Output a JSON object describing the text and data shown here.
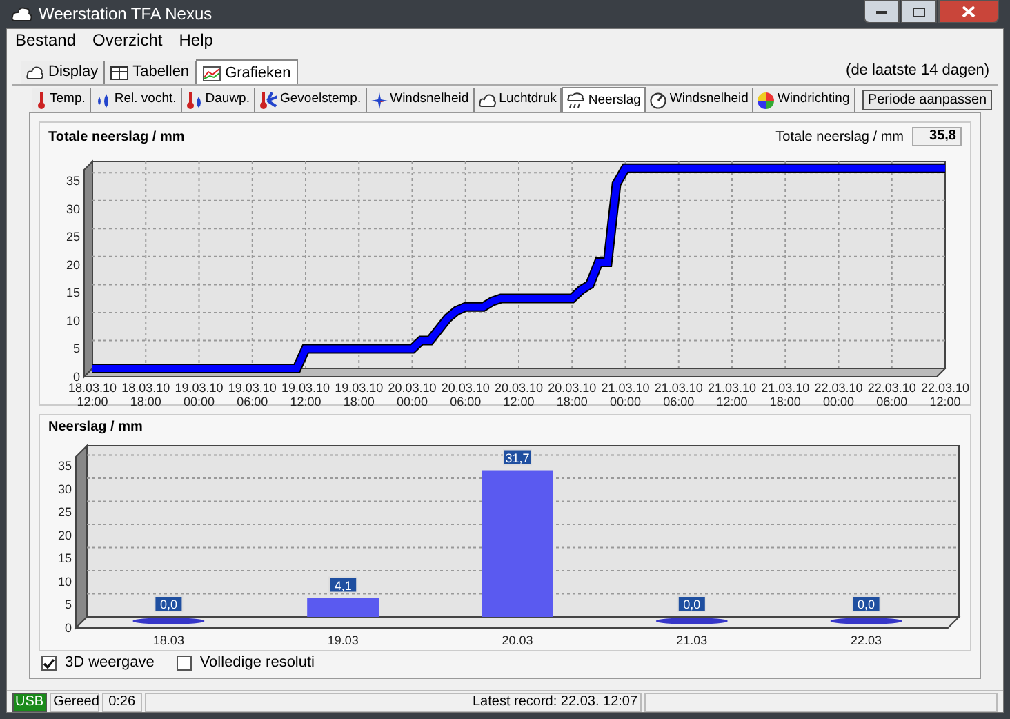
{
  "window": {
    "title": "Weerstation TFA Nexus"
  },
  "menu": [
    "Bestand",
    "Overzicht",
    "Help"
  ],
  "view_tabs": [
    {
      "label": "Display",
      "selected": false
    },
    {
      "label": "Tabellen",
      "selected": false
    },
    {
      "label": "Grafieken",
      "selected": true
    }
  ],
  "period_note": "(de laatste 14 dagen)",
  "chart_tabs": [
    {
      "label": "Temp.",
      "selected": false
    },
    {
      "label": "Rel. vocht.",
      "selected": false
    },
    {
      "label": "Dauwp.",
      "selected": false
    },
    {
      "label": "Gevoelstemp.",
      "selected": false
    },
    {
      "label": "Windsnelheid",
      "selected": false
    },
    {
      "label": "Luchtdruk",
      "selected": false
    },
    {
      "label": "Neerslag",
      "selected": true
    },
    {
      "label": "Windsnelheid",
      "selected": false
    },
    {
      "label": "Windrichting",
      "selected": false
    }
  ],
  "period_button": "Periode aanpassen",
  "total_panel": {
    "readout_label": "Totale neerslag / mm",
    "readout_value": "35,8",
    "chart_data": {
      "type": "line",
      "title": "Totale neerslag / mm",
      "categories": [
        "18.03.10 12:00",
        null,
        null,
        null,
        null,
        null,
        "18.03.10 18:00",
        null,
        null,
        null,
        null,
        null,
        "19.03.10 00:00",
        null,
        null,
        null,
        null,
        null,
        "19.03.10 06:00",
        null,
        null,
        null,
        null,
        null,
        "19.03.10 12:00",
        null,
        null,
        null,
        null,
        null,
        "19.03.10 18:00",
        null,
        null,
        null,
        null,
        null,
        "20.03.10 00:00",
        null,
        null,
        null,
        null,
        null,
        "20.03.10 06:00",
        null,
        null,
        null,
        null,
        null,
        "20.03.10 12:00",
        null,
        null,
        null,
        null,
        null,
        "20.03.10 18:00",
        null,
        null,
        null,
        null,
        null,
        "21.03.10 00:00",
        null,
        null,
        null,
        null,
        null,
        "21.03.10 06:00",
        null,
        null,
        null,
        null,
        null,
        "21.03.10 12:00",
        null,
        null,
        null,
        null,
        null,
        "21.03.10 18:00",
        null,
        null,
        null,
        null,
        null,
        "22.03.10 00:00",
        null,
        null,
        null,
        null,
        null,
        "22.03.10 06:00",
        null,
        null,
        null,
        null,
        null,
        "22.03.10 12:00"
      ],
      "series": [
        {
          "color": "#0000ff",
          "values": [
            0,
            0,
            0,
            0,
            0,
            0,
            0,
            0,
            0,
            0,
            0,
            0,
            0,
            0,
            0,
            0,
            0,
            0,
            0,
            0,
            0,
            0,
            0,
            0,
            3.5,
            3.5,
            3.5,
            3.5,
            3.5,
            3.5,
            3.5,
            3.5,
            3.5,
            3.5,
            3.5,
            3.5,
            3.5,
            5,
            5,
            7,
            9,
            10.3,
            11,
            11,
            11,
            12,
            12.5,
            12.5,
            12.5,
            12.5,
            12.5,
            12.5,
            12.5,
            12.5,
            12.5,
            14,
            15,
            19,
            19,
            33,
            35.8,
            35.8,
            35.8,
            35.8,
            35.8,
            35.8,
            35.8,
            35.8,
            35.8,
            35.8,
            35.8,
            35.8,
            35.8,
            35.8,
            35.8,
            35.8,
            35.8,
            35.8,
            35.8,
            35.8,
            35.8,
            35.8,
            35.8,
            35.8,
            35.8,
            35.8,
            35.8,
            35.8,
            35.8,
            35.8,
            35.8,
            35.8,
            35.8,
            35.8,
            35.8,
            35.8,
            35.8
          ]
        }
      ],
      "ylim": [
        0,
        37
      ],
      "grid": true,
      "yticks": [
        0,
        5,
        10,
        15,
        20,
        25,
        30,
        35
      ]
    }
  },
  "daily_panel": {
    "chart_data": {
      "type": "bar",
      "title": "Neerslag / mm",
      "categories": [
        "18.03",
        "19.03",
        "20.03",
        "21.03",
        "22.03"
      ],
      "series": [
        {
          "color": "#5a5af0",
          "values": [
            0.0,
            4.1,
            31.7,
            0.0,
            0.0
          ]
        }
      ],
      "grid": true,
      "value_labels": [
        "0,0",
        "4,1",
        "31,7",
        "0,0",
        "0,0"
      ],
      "ylim": [
        0,
        37
      ],
      "yticks": [
        0,
        5,
        10,
        15,
        20,
        25,
        30,
        35
      ]
    }
  },
  "options": [
    {
      "label": "3D weergave",
      "checked": true
    },
    {
      "label": "Volledige resoluti",
      "checked": false
    }
  ],
  "status_bar": {
    "connection": "USB",
    "state": "Gereed",
    "time": "0:26",
    "latest": "Latest record: 22.03. 12:07"
  }
}
